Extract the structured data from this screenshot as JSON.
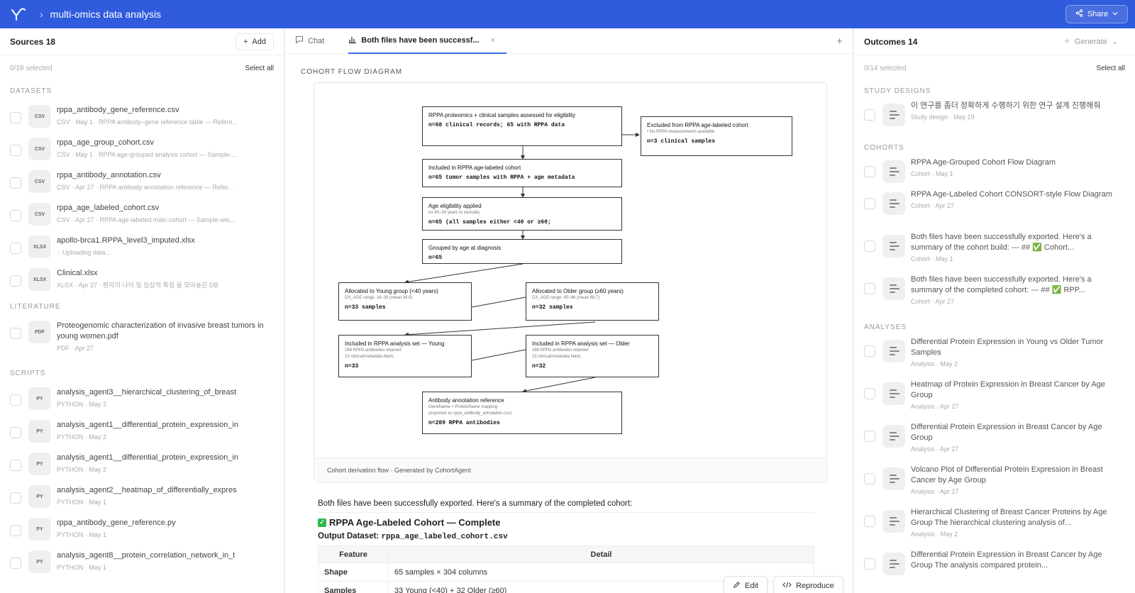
{
  "header": {
    "breadcrumb_sep": "›",
    "title": "multi-omics data analysis",
    "share_label": "Share"
  },
  "sources": {
    "title": "Sources 18",
    "add_label": "Add",
    "selected": "0/18 selected",
    "select_all": "Select all",
    "sections": {
      "datasets": "DATASETS",
      "literature": "LITERATURE",
      "scripts": "SCRIPTS"
    },
    "datasets": [
      {
        "type": "CSV",
        "name": "rppa_antibody_gene_reference.csv",
        "meta": "CSV · May 1 · RPPA antibody–gene reference table — Refere..."
      },
      {
        "type": "CSV",
        "name": "rppa_age_group_cohort.csv",
        "meta": "CSV · May 1 · RPPA age-grouped analysis cohort — Sample-..."
      },
      {
        "type": "CSV",
        "name": "rppa_antibody_annotation.csv",
        "meta": "CSV · Apr 27 · RPPA antibody annotation reference — Refer..."
      },
      {
        "type": "CSV",
        "name": "rppa_age_labeled_cohort.csv",
        "meta": "CSV · Apr 27 · RPPA age-labeled main cohort — Sample-wis..."
      },
      {
        "type": "XLSX",
        "name": "apollo-brca1.RPPA_level3_imputed.xlsx",
        "meta": "Uploading data..."
      },
      {
        "type": "XLSX",
        "name": "Clinical.xlsx",
        "meta": "XLSX · Apr 27 · 환자의 나이 및 임상적 특징 을 모아놓은 DB"
      }
    ],
    "literature": [
      {
        "type": "PDF",
        "name": "Proteogenomic characterization of invasive breast tumors in young women.pdf",
        "meta": "PDF · Apr 27"
      }
    ],
    "scripts": [
      {
        "type": "PY",
        "name": "analysis_agent3__hierarchical_clustering_of_breast",
        "meta": "PYTHON · May 2"
      },
      {
        "type": "PY",
        "name": "analysis_agent1__differential_protein_expression_in",
        "meta": "PYTHON · May 2"
      },
      {
        "type": "PY",
        "name": "analysis_agent1__differential_protein_expression_in",
        "meta": "PYTHON · May 2"
      },
      {
        "type": "PY",
        "name": "analysis_agent2__heatmap_of_differentially_expres",
        "meta": "PYTHON · May 1"
      },
      {
        "type": "PY",
        "name": "rppa_antibody_gene_reference.py",
        "meta": "PYTHON · May 1"
      },
      {
        "type": "PY",
        "name": "analysis_agent8__protein_correlation_network_in_t",
        "meta": "PYTHON · May 1"
      }
    ]
  },
  "tabs": [
    {
      "label": "Chat"
    },
    {
      "label": "Both files have been successf..."
    }
  ],
  "diagram": {
    "section_label": "COHORT FLOW DIAGRAM",
    "footer": "Cohort derivation flow · Generated by CohortAgent",
    "boxes": {
      "assessed": {
        "title": "RPPA proteomics + clinical samples assessed for eligibility",
        "n": "n=68 clinical records; 65 with RPPA data"
      },
      "excluded": {
        "title": "Excluded from RPPA age-labeled cohort",
        "sub": "• No RPPA measurements available",
        "n": "n=3 clinical samples"
      },
      "included": {
        "title": "Included in RPPA age-labeled cohort",
        "n": "n=65 tumor samples with RPPA + age metadata"
      },
      "eligibility": {
        "title": "Age eligibility applied",
        "sub": "no 40–59 years to exclude)",
        "n": "n=65 (all samples either <40 or ≥60;"
      },
      "grouped": {
        "title": "Grouped by age at diagnosis",
        "n": "n=65"
      },
      "young": {
        "title": "Allocated to Young group (<40 years)",
        "sub": "DX_AGE range: 18–39 (mean 34.6)",
        "n": "n=33 samples"
      },
      "older": {
        "title": "Allocated to Older group (≥60 years)",
        "sub": "DX_AGE range: 60–86 (mean 68.7)",
        "n": "n=32 samples"
      },
      "set_young": {
        "title": "Included in RPPA analysis set — Young",
        "sub1": "289 RPPA antibodies retained",
        "sub2": "15 clinical/metadata fields",
        "n": "n=33"
      },
      "set_older": {
        "title": "Included in RPPA analysis set — Older",
        "sub1": "289 RPPA antibodies retained",
        "sub2": "15 clinical/metadata fields",
        "n": "n=32"
      },
      "annotation": {
        "title": "Antibody annotation reference",
        "sub1": "GeneName + ProteinName mapping",
        "sub2": "(exported as rppa_antibody_annotation.csv)",
        "n": "n=289 RPPA antibodies"
      }
    }
  },
  "summary": {
    "intro": "Both files have been successfully exported. Here's a summary of the completed cohort:",
    "heading": "RPPA Age-Labeled Cohort — Complete",
    "output_label": "Output Dataset:",
    "output_file": "rppa_age_labeled_cohort.csv",
    "table": {
      "headers": [
        "Feature",
        "Detail"
      ],
      "rows": [
        {
          "feature": "Shape",
          "detail": "65 samples × 304 columns"
        },
        {
          "feature": "Samples",
          "detail": "33 Young (<40) + 32 Older (≥60)"
        }
      ]
    },
    "edit_label": "Edit",
    "reproduce_label": "Reproduce"
  },
  "outcomes": {
    "title": "Outcomes 14",
    "generate_label": "Generate",
    "selected": "0/14 selected",
    "select_all": "Select all",
    "sections": {
      "study_designs": "STUDY DESIGNS",
      "cohorts": "COHORTS",
      "analyses": "ANALYSES"
    },
    "study_designs": [
      {
        "name": "이 연구를 좀더 정확하게 수행하기 위한 연구 설계 진행해줘",
        "meta": "Study design · May 19"
      }
    ],
    "cohorts": [
      {
        "name": "RPPA Age-Grouped Cohort Flow Diagram",
        "meta": "Cohort · May 1"
      },
      {
        "name": "RPPA Age-Labeled Cohort CONSORT-style Flow Diagram",
        "meta": "Cohort · Apr 27"
      },
      {
        "name": "Both files have been successfully exported. Here's a summary of the cohort build: --- ## ✅ Cohort...",
        "meta": "Cohort · May 1"
      },
      {
        "name": "Both files have been successfully exported. Here's a summary of the completed cohort: --- ## ✅ RPP...",
        "meta": "Cohort · Apr 27"
      }
    ],
    "analyses": [
      {
        "name": "Differential Protein Expression in Young vs Older Tumor Samples",
        "meta": "Analysis · May 2"
      },
      {
        "name": "Heatmap of Protein Expression in Breast Cancer by Age Group",
        "meta": "Analysis · Apr 27"
      },
      {
        "name": "Differential Protein Expression in Breast Cancer by Age Group",
        "meta": "Analysis · Apr 27"
      },
      {
        "name": "Volcano Plot of Differential Protein Expression in Breast Cancer by Age Group",
        "meta": "Analysis · Apr 27"
      },
      {
        "name": "Hierarchical Clustering of Breast Cancer Proteins by Age Group The hierarchical clustering analysis of...",
        "meta": "Analysis · May 2"
      },
      {
        "name": "Differential Protein Expression in Breast Cancer by Age Group The analysis compared protein...",
        "meta": ""
      }
    ]
  },
  "colors": {
    "brand": "#2f5bdc",
    "accent": "#3b6df1",
    "check": "#2eb84a"
  }
}
